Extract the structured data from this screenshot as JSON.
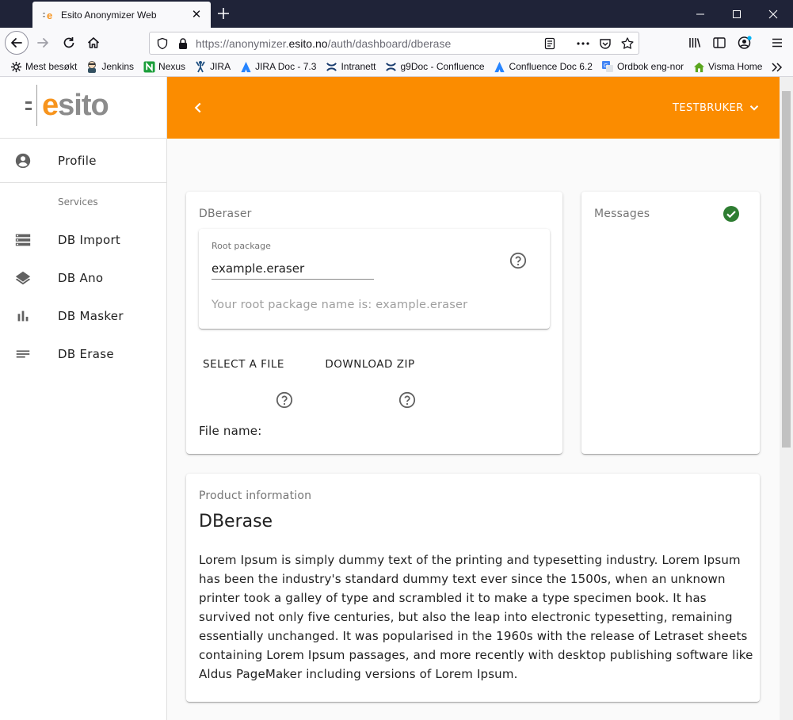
{
  "browser": {
    "tab_title": "Esito Anonymizer Web",
    "url_prefix": "https://anonymizer.",
    "url_host": "esito.no",
    "url_path": "/auth/dashboard/dberase",
    "bookmarks": [
      {
        "label": "Mest besøkt",
        "icon": "gear-icon"
      },
      {
        "label": "Jenkins",
        "icon": "jenkins-icon"
      },
      {
        "label": "Nexus",
        "icon": "nexus-icon"
      },
      {
        "label": "JIRA",
        "icon": "jira-icon"
      },
      {
        "label": "JIRA Doc - 7.3",
        "icon": "atlassian-icon"
      },
      {
        "label": "Intranett",
        "icon": "confluence-icon"
      },
      {
        "label": "g9Doc - Confluence",
        "icon": "confluence-icon"
      },
      {
        "label": "Confluence Doc 6.2",
        "icon": "atlassian-icon"
      },
      {
        "label": "Ordbok eng-nor",
        "icon": "google-translate-icon"
      },
      {
        "label": "Visma Home",
        "icon": "home-icon"
      }
    ]
  },
  "brand": {
    "logo_e": "e",
    "logo_rest": "sito",
    "accent": "#fb8c00",
    "logo_orange": "#f7941d"
  },
  "sidebar": {
    "profile_label": "Profile",
    "services_label": "Services",
    "items": [
      {
        "label": "DB Import",
        "icon": "storage-icon"
      },
      {
        "label": "DB Ano",
        "icon": "layers-icon"
      },
      {
        "label": "DB Masker",
        "icon": "bar-chart-icon"
      },
      {
        "label": "DB Erase",
        "icon": "notes-icon"
      }
    ]
  },
  "topbar": {
    "user_label": "TESTBRUKER"
  },
  "eraser": {
    "title": "DBeraser",
    "field_label": "Root package",
    "root_value": "example.eraser",
    "root_message": "Your root package name is: example.eraser",
    "select_file": "SELECT A FILE",
    "download_zip": "DOWNLOAD ZIP",
    "file_name_label": "File name:"
  },
  "messages": {
    "title": "Messages",
    "status_color": "#2e7d32"
  },
  "product": {
    "title": "Product information",
    "heading": "DBerase",
    "text": "Lorem Ipsum is simply dummy text of the printing and typesetting industry. Lorem Ipsum has been the industry's standard dummy text ever since the 1500s, when an unknown printer took a galley of type and scrambled it to make a type specimen book. It has survived not only five centuries, but also the leap into electronic typesetting, remaining essentially unchanged. It was popularised in the 1960s with the release of Letraset sheets containing Lorem Ipsum passages, and more recently with desktop publishing software like Aldus PageMaker including versions of Lorem Ipsum."
  }
}
